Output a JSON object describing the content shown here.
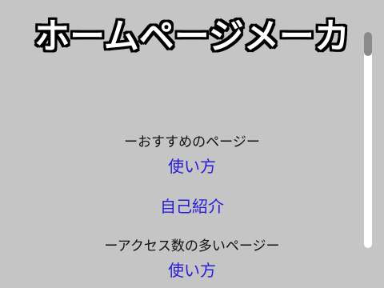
{
  "site": {
    "title": "ホームページメーカ"
  },
  "recommended": {
    "heading": "ーおすすめのページー",
    "links": [
      "使い方",
      "自己紹介"
    ]
  },
  "popular": {
    "heading": "ーアクセス数の多いページー",
    "links": [
      "使い方"
    ]
  },
  "colors": {
    "background": "#c5c5c5",
    "link": "#2a1bd6",
    "title_fill": "#ffffff",
    "title_outline": "#000000"
  }
}
